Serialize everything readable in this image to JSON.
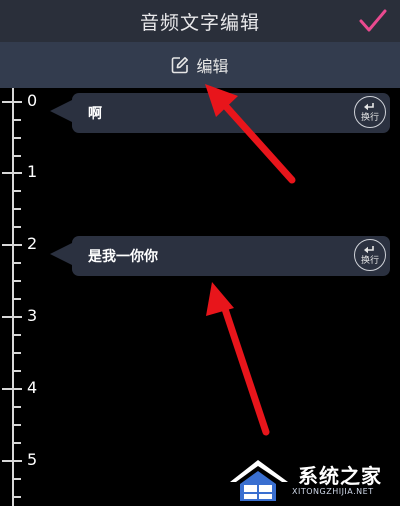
{
  "header": {
    "title": "音频文字编辑",
    "confirm_icon": "checkmark-icon",
    "accent": "#e94a8f"
  },
  "editbar": {
    "label": "编辑",
    "icon": "edit-icon"
  },
  "timeline": {
    "labels": [
      "0",
      "1",
      "2",
      "3",
      "4",
      "5"
    ]
  },
  "subtitles": [
    {
      "text": "啊",
      "action_label": "换行"
    },
    {
      "text": "是我一你你",
      "action_label": "换行"
    }
  ],
  "watermark": {
    "brand": "系统之家",
    "url": "XITONGZHIJIA.NET"
  },
  "colors": {
    "arrow": "#e8151b",
    "header_bg": "#2a2f3a",
    "editbar_bg": "#333c4e",
    "bubble_bg": "#2b3140"
  }
}
